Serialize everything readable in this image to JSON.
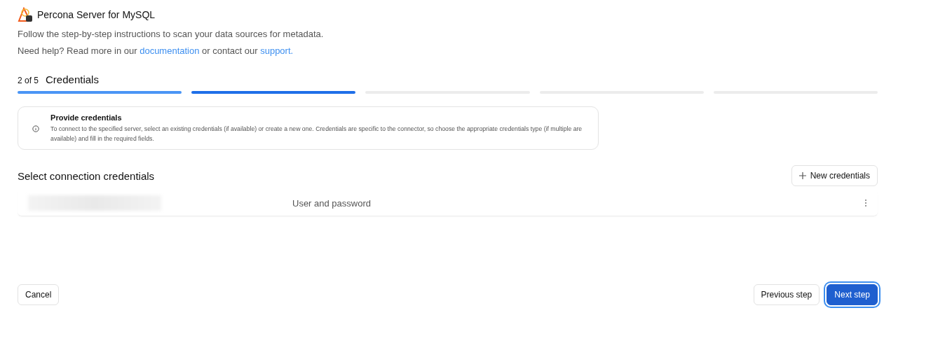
{
  "header": {
    "title": "Percona Server for MySQL",
    "subtitle": "Follow the step-by-step instructions to scan your data sources for metadata.",
    "help": [
      {
        "kind": "text",
        "text": "Need help? Read more in our "
      },
      {
        "kind": "link",
        "text": "documentation"
      },
      {
        "kind": "text",
        "text": " or contact our "
      },
      {
        "kind": "link",
        "text": "support."
      }
    ]
  },
  "stepper": {
    "counter": "2 of 5",
    "title": "Credentials",
    "steps": [
      {
        "completed": true,
        "selected": false
      },
      {
        "completed": false,
        "selected": true
      },
      {
        "completed": false,
        "selected": false
      },
      {
        "completed": false,
        "selected": false
      },
      {
        "completed": false,
        "selected": false
      }
    ]
  },
  "info": {
    "title": "Provide credentials",
    "text": "To connect to the specified server, select an existing credentials (if available) or create a new one. Credentials are specific to the connector, so choose the appropriate credentials type (if multiple are available) and fill in the required fields."
  },
  "section": {
    "title": "Select connection credentials",
    "new_button": "New credentials"
  },
  "credentials": [
    {
      "type": "User and password"
    }
  ],
  "footer": {
    "cancel": "Cancel",
    "previous": "Previous step",
    "next": "Next step"
  }
}
